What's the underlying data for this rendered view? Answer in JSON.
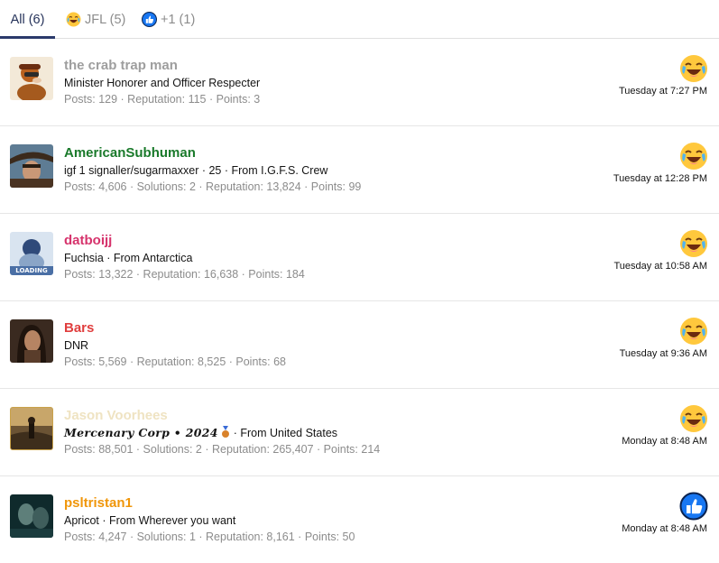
{
  "tabs": [
    {
      "label": "All (6)",
      "active": true
    },
    {
      "label": "JFL (5)",
      "icon": "laughing-emoji-icon"
    },
    {
      "label": "+1 (1)",
      "icon": "thumbs-up-icon"
    }
  ],
  "reactions": [
    {
      "username": "the crab trap man",
      "username_color": "#9e9e9e",
      "title": "Minister Honorer and Officer Respecter",
      "stats": "Posts: 129 · Reputation: 115 · Points: 3",
      "reaction_icon": "laughing-emoji-icon",
      "time": "Tuesday at 7:27 PM"
    },
    {
      "username": "AmericanSubhuman",
      "username_color": "#1a7a2b",
      "title": "igf 1 signaller/sugarmaxxer · 25 · From I.G.F.S. Crew",
      "stats": "Posts: 4,606 · Solutions: 2 · Reputation: 13,824 · Points: 99",
      "reaction_icon": "laughing-emoji-icon",
      "time": "Tuesday at 12:28 PM"
    },
    {
      "username": "datboijj",
      "username_color": "#d6336c",
      "title": "Fuchsia · From Antarctica",
      "stats": "Posts: 13,322 · Reputation: 16,638 · Points: 184",
      "reaction_icon": "laughing-emoji-icon",
      "time": "Tuesday at 10:58 AM"
    },
    {
      "username": "Bars",
      "username_color": "#e03e3e",
      "title": "DNR",
      "stats": "Posts: 5,569 · Reputation: 8,525 · Points: 68",
      "reaction_icon": "laughing-emoji-icon",
      "time": "Tuesday at 9:36 AM"
    },
    {
      "username": "Jason Voorhees",
      "username_color": "#efe3c2",
      "title_main": "Mercenary Corp • 2024",
      "title_rest": " · From United States",
      "stats": "Posts: 88,501 · Solutions: 2 · Reputation: 265,407 · Points: 214",
      "reaction_icon": "laughing-emoji-icon",
      "time": "Monday at 8:48 AM"
    },
    {
      "username": "psltristan1",
      "username_color": "#f0960a",
      "title": "Apricot · From Wherever you want",
      "stats": "Posts: 4,247 · Solutions: 1 · Reputation: 8,161 · Points: 50",
      "reaction_icon": "thumbs-up-icon",
      "time": "Monday at 8:48 AM"
    }
  ]
}
